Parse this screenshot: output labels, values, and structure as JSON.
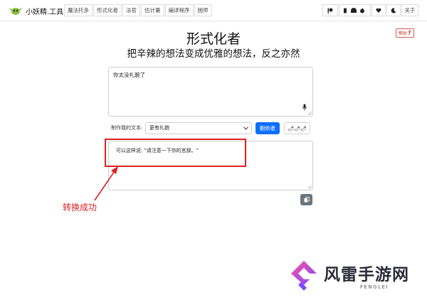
{
  "app": {
    "title": "小妖精.工具"
  },
  "nav": {
    "items": [
      "魔法托多",
      "形式化者",
      "法官",
      "估计量",
      "编译程序",
      "困师"
    ]
  },
  "nav_right": {
    "about_label": "关于"
  },
  "help": {
    "label": "帮助",
    "mark": "?"
  },
  "page": {
    "title": "形式化者",
    "subtitle": "把辛辣的想法变成优雅的想法，反之亦然"
  },
  "input": {
    "value": "你太没礼貌了"
  },
  "controls": {
    "make_label": "制作我的文本:",
    "selected_option": "更有礼貌",
    "submit_label": "橱依者",
    "spiciness": "🌶🌶🌶"
  },
  "output": {
    "text": "可以这样说: \"请注意一下你的言辞。\""
  },
  "annotation": {
    "label": "转换成功",
    "color": "#e02020"
  },
  "watermark": {
    "title": "风雷手游网",
    "subtitle": "FENGLEI"
  },
  "colors": {
    "primary": "#0d6efd",
    "copy_button": "#6c757d",
    "help": "#d9534f"
  }
}
